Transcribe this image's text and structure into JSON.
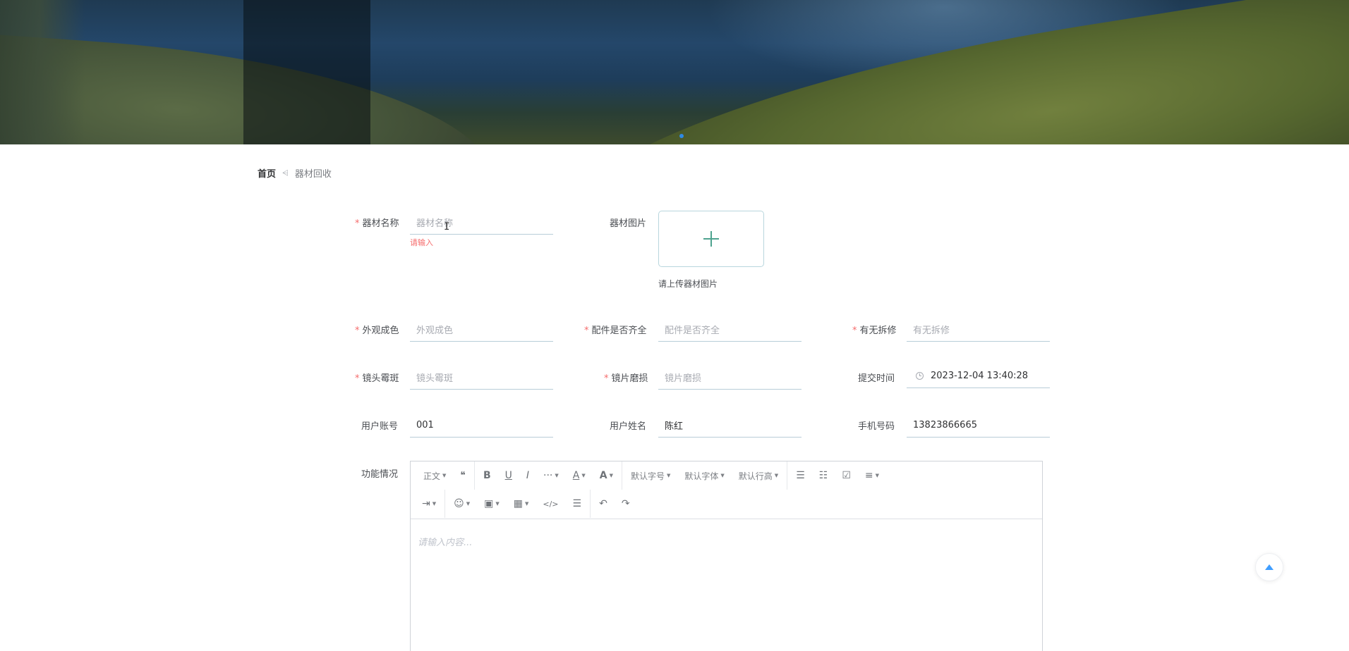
{
  "breadcrumb": {
    "home": "首页",
    "separator": "⩤",
    "current": "器材回收"
  },
  "form": {
    "name": {
      "label": "器材名称",
      "required": "*",
      "placeholder": "器材名称",
      "error": "请输入"
    },
    "image": {
      "label": "器材图片",
      "hint": "请上传器材图片"
    },
    "appearance": {
      "label": "外观成色",
      "required": "*",
      "placeholder": "外观成色"
    },
    "accessories": {
      "label": "配件是否齐全",
      "required": "*",
      "placeholder": "配件是否齐全"
    },
    "repair": {
      "label": "有无拆修",
      "required": "*",
      "placeholder": "有无拆修"
    },
    "lens_mold": {
      "label": "镜头霉斑",
      "required": "*",
      "placeholder": "镜头霉斑"
    },
    "lens_wear": {
      "label": "镜片磨损",
      "required": "*",
      "placeholder": "镜片磨损"
    },
    "submit_time": {
      "label": "提交时间",
      "value": "2023-12-04 13:40:28"
    },
    "account": {
      "label": "用户账号",
      "value": "001"
    },
    "username": {
      "label": "用户姓名",
      "value": "陈红"
    },
    "phone": {
      "label": "手机号码",
      "value": "13823866665"
    },
    "function": {
      "label": "功能情况"
    }
  },
  "editor": {
    "placeholder": "请输入内容...",
    "toolbar": {
      "paragraph": "正文",
      "quote": "❝",
      "bold": "B",
      "underline": "U",
      "italic": "I",
      "more": "···",
      "font_color": "A",
      "bg_color": "A",
      "font_size": "默认字号",
      "font_family": "默认字体",
      "line_height": "默认行高",
      "bullet_list": "☰",
      "numbered_list": "☷",
      "todo": "☑",
      "align": "≡",
      "indent": "⇥",
      "emoji": "☺",
      "image": "▣",
      "table": "▦",
      "code": "</>",
      "divider": "☰",
      "undo": "↶",
      "redo": "↷",
      "caret": "▼"
    }
  },
  "colors": {
    "accent": "#409eff",
    "required": "#f56c6c",
    "upload_plus": "#4ea38f"
  }
}
